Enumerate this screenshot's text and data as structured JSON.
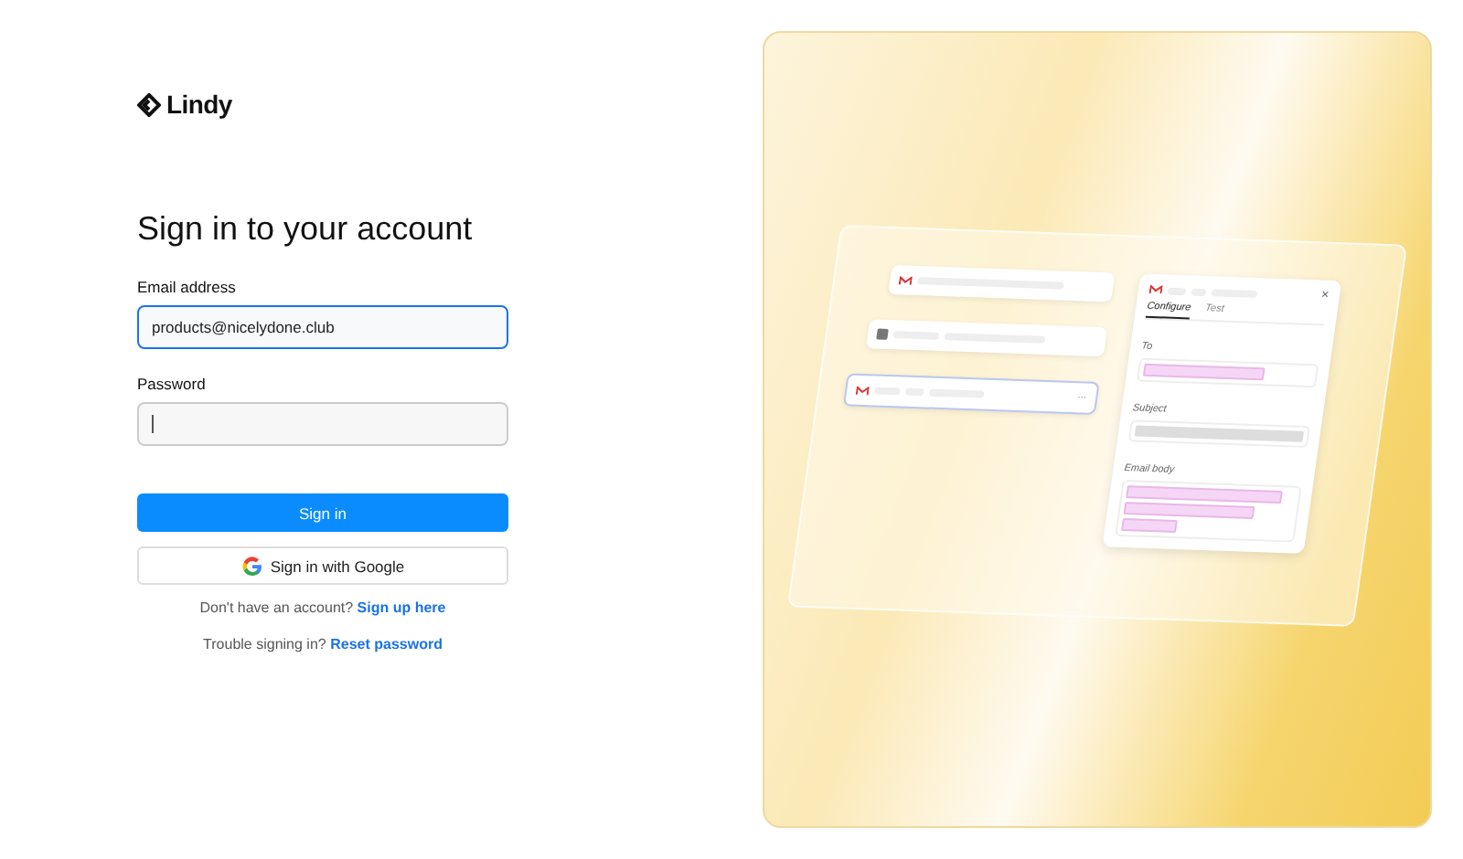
{
  "logo": {
    "text": "Lindy"
  },
  "heading": "Sign in to your account",
  "email": {
    "label": "Email address",
    "value": "products@nicelydone.club",
    "focused": true
  },
  "password": {
    "label": "Password"
  },
  "sign_in_button": "Sign in",
  "google_button": "Sign in with Google",
  "signup": {
    "text": "Don't have an account?",
    "link": "Sign up here"
  },
  "reset": {
    "text": "Trouble signing in?",
    "link": "Reset password"
  },
  "preview": {
    "more": "···",
    "close": "×",
    "tabs": [
      {
        "label": "Configure",
        "selected": true
      },
      {
        "label": "Test",
        "selected": false
      }
    ],
    "fields": [
      {
        "label": "To",
        "kind": "pink"
      },
      {
        "label": "Subject",
        "kind": "grey"
      },
      {
        "label": "Email body",
        "kind": "multi"
      }
    ]
  }
}
